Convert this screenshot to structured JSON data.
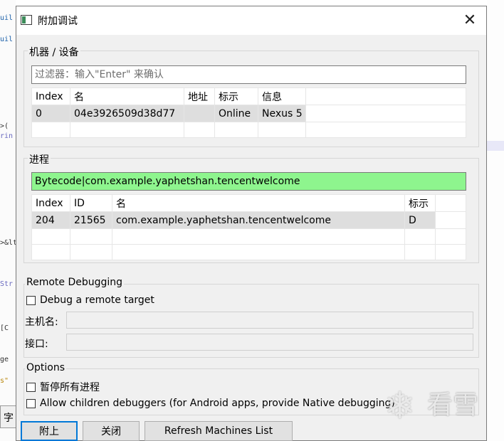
{
  "background": {
    "code_fragments": [
      "uil",
      "uil",
      "",
      "",
      "",
      ">(",
      "rin",
      "",
      ">&lt;i",
      "",
      "Str",
      "",
      "",
      "[C",
      "",
      "ge",
      "s\""
    ],
    "bottom_tab": "字"
  },
  "window": {
    "title": "附加调试",
    "close_glyph": "✕"
  },
  "machines": {
    "group_label": "机器 / 设备",
    "filter_placeholder": "过滤器：输入\"Enter\" 来确认",
    "filter_value": "",
    "columns": [
      "Index",
      "名",
      "地址",
      "标示",
      "信息"
    ],
    "rows": [
      [
        "0",
        "04e3926509d38d77",
        "",
        "Online",
        "Nexus 5"
      ]
    ]
  },
  "processes": {
    "group_label": "进程",
    "filter_value": "Bytecode|com.example.yaphetshan.tencentwelcome",
    "filter_bg": "#8ef58e",
    "columns": [
      "Index",
      "ID",
      "名",
      "标示"
    ],
    "rows": [
      [
        "204",
        "21565",
        "com.example.yaphetshan.tencentwelcome",
        "D"
      ]
    ]
  },
  "remote": {
    "group_label": "Remote Debugging",
    "checkbox_label": "Debug a remote target",
    "host_label": "主机名:",
    "port_label": "接口:",
    "host_value": "",
    "port_value": ""
  },
  "options": {
    "group_label": "Options",
    "pause_label": "暂停所有进程",
    "children_label": "Allow children debuggers (for Android apps, provide Native debugging)"
  },
  "buttons": {
    "attach": "附上",
    "close": "关闭",
    "refresh": "Refresh Machines List"
  },
  "watermark": {
    "text": "看雪",
    "icon": "snowflake-icon"
  },
  "colors": {
    "selection": "#dedede",
    "accent": "#0078d7"
  }
}
